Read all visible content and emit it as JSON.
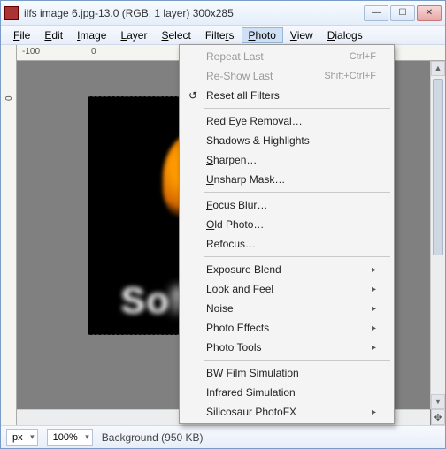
{
  "window": {
    "title": "ilfs image 6.jpg-13.0 (RGB, 1 layer) 300x285"
  },
  "menubar": {
    "file": "File",
    "edit": "Edit",
    "image": "Image",
    "layer": "Layer",
    "select": "Select",
    "filters": "Filters",
    "photo": "Photo",
    "view": "View",
    "dialogs": "Dialogs"
  },
  "ruler": {
    "h_m100": "-100",
    "h_0": "0",
    "v_0": "0"
  },
  "photo_menu": {
    "repeat_last": "Repeat Last",
    "repeat_last_sc": "Ctrl+F",
    "reshow_last": "Re-Show Last",
    "reshow_last_sc": "Shift+Ctrl+F",
    "reset_all": "Reset all Filters",
    "red_eye": "Red Eye Removal…",
    "shadows": "Shadows & Highlights",
    "sharpen": "Sharpen…",
    "unsharp": "Unsharp Mask…",
    "focus_blur": "Focus Blur…",
    "old_photo": "Old Photo…",
    "refocus": "Refocus…",
    "exposure_blend": "Exposure Blend",
    "look_feel": "Look and Feel",
    "noise": "Noise",
    "photo_effects": "Photo Effects",
    "photo_tools": "Photo Tools",
    "bw_film": "BW Film Simulation",
    "infrared": "Infrared Simulation",
    "silicosaur": "Silicosaur PhotoFX",
    "reset_icon": "↺"
  },
  "canvas_text": {
    "line1": "F",
    "line2": "So\u0000ware"
  },
  "status": {
    "unit": "px",
    "zoom": "100%",
    "status": "Background (950 KB)"
  },
  "icons": {
    "min": "—",
    "max": "☐",
    "close": "✕",
    "nav": "✥",
    "arrow": "▸",
    "up": "▲",
    "down": "▼"
  }
}
